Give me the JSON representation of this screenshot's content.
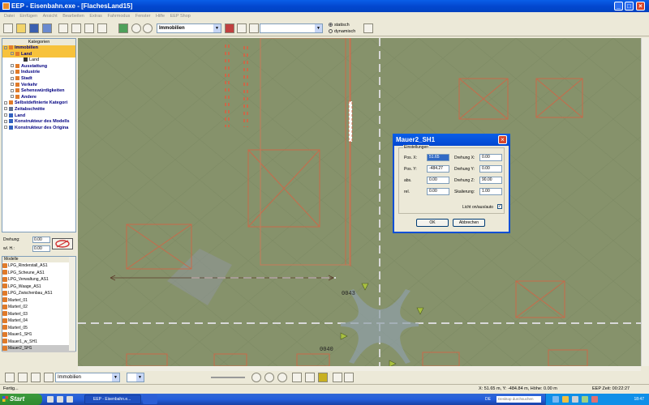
{
  "window": {
    "title": "EEP - Eisenbahn.exe - [FlachesLand15]"
  },
  "menu": [
    "Datei",
    "Einfügen",
    "Ansicht",
    "Bearbeiten",
    "Extras",
    "Fahrmodus",
    "Fenster",
    "Hilfe",
    "EEP Shop"
  ],
  "toolbar": {
    "category_combo": "Immobilien",
    "second_combo": "",
    "radio_static": "statisch",
    "radio_dynamic": "dynamisch"
  },
  "catalog": {
    "header": "Kategorien",
    "items": [
      "Immobilien",
      "Land",
      "Land",
      "Ausstattung",
      "Industrie",
      "Stadt",
      "Verkehr",
      "Sehenswürdigkeiten",
      "Andere",
      "Selbstdefinierte Kategori",
      "Zeitabschnitte",
      "Land",
      "Konstrukteur des Modells",
      "Konstrukteur des Origina"
    ]
  },
  "fields": {
    "rotation_label": "Drehung:",
    "rotation_value": "0.00",
    "wm_label": "wl. H.:",
    "wm_value": "0.00"
  },
  "models": {
    "header": "Modelle",
    "items": [
      "LPG_Rinderstall_AS1",
      "LPG_Scheune_AS1",
      "LPG_Verwaltung_AS1",
      "LPG_Waage_AS1",
      "LPG_Zwischenbau_AS1",
      "Marterl_01",
      "Marterl_02",
      "Marterl_03",
      "Marterl_04",
      "Marterl_05",
      "Mauer1_SH1",
      "Mauer1_w_SH1",
      "Mauer2_SH1"
    ]
  },
  "map_labels": [
    "0043",
    "0040"
  ],
  "dialog": {
    "title": "Mauer2_SH1",
    "group": "Einstellungen",
    "pos_x_label": "Pos. X:",
    "pos_x": "51.65",
    "pos_y_label": "Pos. Y:",
    "pos_y": "-484.27",
    "abs_label": "abs.",
    "abs": "0.00",
    "rel_label": "rel.",
    "rel": "0.00",
    "rot_x_label": "Drehung X:",
    "rot_x": "0.00",
    "rot_y_label": "Drehung Y:",
    "rot_y": "0.00",
    "rot_z_label": "Drehung Z:",
    "rot_z": "90.00",
    "scale_label": "Skalierung:",
    "scale": "1.00",
    "light_label": "Licht on/aus/auto",
    "ok": "OK",
    "cancel": "Abbrechen"
  },
  "bottom_toolbar": {
    "layer_combo": "Immobilien"
  },
  "status": {
    "left": "Fertig...",
    "coords": "X: 51.65 m, Y: -484.84 m, Höhe: 0.00 m",
    "time": "EEP Zeit: 00:22:27"
  },
  "taskbar": {
    "start": "Start",
    "task_label": "EEP - Eisenbahn.e...",
    "language": "DE",
    "search_placeholder": "Desktop durchsuchen",
    "clock": "18:47"
  }
}
